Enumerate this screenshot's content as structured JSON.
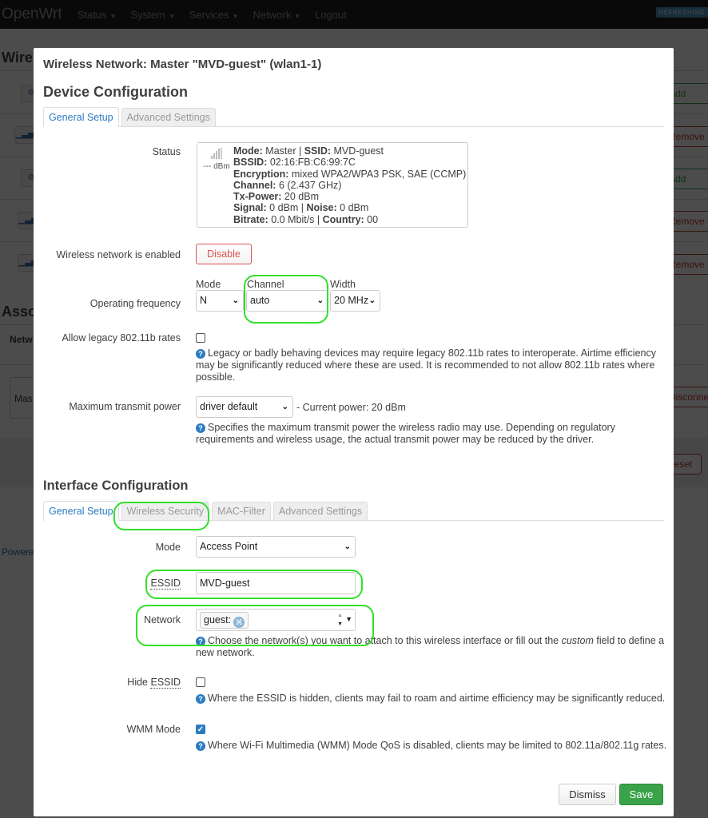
{
  "topbar": {
    "brand": "OpenWrt",
    "nav": [
      "Status",
      "System",
      "Services",
      "Network",
      "Logout"
    ],
    "refresh_badge": "REFRESHING"
  },
  "background": {
    "heading_wireless": "Wirel",
    "heading_assoc": "Asso",
    "col_network": "Netw",
    "cell_master": "Mas",
    "buttons": [
      "Add",
      "Remove",
      "Add",
      "Remove",
      "Remove",
      "Disconnect",
      "Reset"
    ],
    "footer": "Powere"
  },
  "modal": {
    "title": "Wireless Network: Master \"MVD-guest\" (wlan1-1)",
    "device_section": {
      "title": "Device Configuration",
      "tabs": [
        {
          "label": "General Setup",
          "active": true
        },
        {
          "label": "Advanced Settings",
          "active": false
        }
      ],
      "status": {
        "label": "Status",
        "signal_text": "--- dBm",
        "lines": [
          [
            {
              "k": "Mode:",
              "v": " Master | "
            },
            {
              "k": "SSID:",
              "v": " MVD-guest"
            }
          ],
          [
            {
              "k": "BSSID:",
              "v": " 02:16:FB:C6:99:7C"
            }
          ],
          [
            {
              "k": "Encryption:",
              "v": " mixed WPA2/WPA3 PSK, SAE (CCMP)"
            }
          ],
          [
            {
              "k": "Channel:",
              "v": " 6 (2.437 GHz)"
            }
          ],
          [
            {
              "k": "Tx-Power:",
              "v": " 20 dBm"
            }
          ],
          [
            {
              "k": "Signal:",
              "v": " 0 dBm | "
            },
            {
              "k": "Noise:",
              "v": " 0 dBm"
            }
          ],
          [
            {
              "k": "Bitrate:",
              "v": " 0.0 Mbit/s | "
            },
            {
              "k": "Country:",
              "v": " 00"
            }
          ]
        ]
      },
      "enabled": {
        "label": "Wireless network is enabled",
        "button": "Disable"
      },
      "frequency": {
        "label": "Operating frequency",
        "mode_label": "Mode",
        "mode_value": "N",
        "channel_label": "Channel",
        "channel_value": "auto",
        "width_label": "Width",
        "width_value": "20 MHz"
      },
      "legacy": {
        "label": "Allow legacy 802.11b rates",
        "checked": false,
        "help": "Legacy or badly behaving devices may require legacy 802.11b rates to interoperate. Airtime efficiency may be significantly reduced where these are used. It is recommended to not allow 802.11b rates where possible."
      },
      "txpower": {
        "label": "Maximum transmit power",
        "value": "driver default",
        "current": "- Current power: 20 dBm",
        "help": "Specifies the maximum transmit power the wireless radio may use. Depending on regulatory requirements and wireless usage, the actual transmit power may be reduced by the driver."
      }
    },
    "interface_section": {
      "title": "Interface Configuration",
      "tabs": [
        {
          "label": "General Setup",
          "active": true
        },
        {
          "label": "Wireless Security",
          "active": false
        },
        {
          "label": "MAC-Filter",
          "active": false
        },
        {
          "label": "Advanced Settings",
          "active": false
        }
      ],
      "mode": {
        "label": "Mode",
        "value": "Access Point"
      },
      "essid": {
        "label": "ESSID",
        "value": "MVD-guest"
      },
      "network": {
        "label": "Network",
        "chip": "guest:",
        "help_pre": "Choose the network(s) you want to attach to this wireless interface or fill out the ",
        "help_em": "custom",
        "help_post": " field to define a new network."
      },
      "hide_essid": {
        "label_pre": "Hide ",
        "label_abbr": "ESSID",
        "checked": false,
        "help": "Where the ESSID is hidden, clients may fail to roam and airtime efficiency may be significantly reduced."
      },
      "wmm": {
        "label": "WMM Mode",
        "checked": true,
        "help": "Where Wi-Fi Multimedia (WMM) Mode QoS is disabled, clients may be limited to 802.11a/802.11g rates."
      }
    },
    "footer": {
      "dismiss": "Dismiss",
      "save": "Save"
    }
  }
}
